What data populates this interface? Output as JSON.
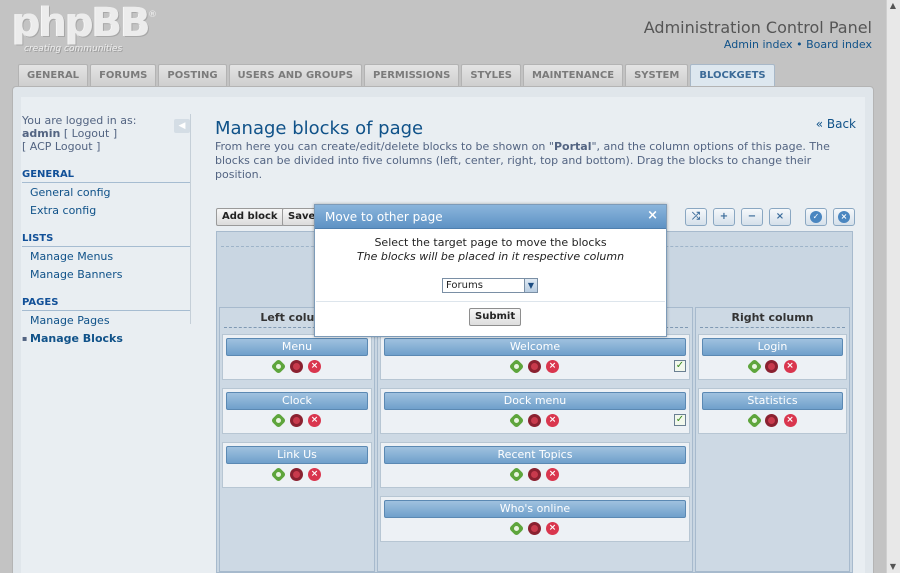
{
  "header": {
    "logo_text": "phpBB",
    "logo_tagline": "creating communities",
    "title": "Administration Control Panel",
    "links": [
      "Admin index",
      "Board index"
    ],
    "link_separator": "•"
  },
  "tabs": [
    "GENERAL",
    "FORUMS",
    "POSTING",
    "USERS AND GROUPS",
    "PERMISSIONS",
    "STYLES",
    "MAINTENANCE",
    "SYSTEM",
    "BLOCKGETS"
  ],
  "active_tab": "BLOCKGETS",
  "sidebar": {
    "logged_in_label": "You are logged in as:",
    "username": "admin",
    "logout": "[ Logout ]",
    "acp_logout": "[ ACP Logout ]",
    "sections": [
      {
        "title": "GENERAL",
        "items": [
          "General config",
          "Extra config"
        ]
      },
      {
        "title": "LISTS",
        "items": [
          "Manage Menus",
          "Manage Banners"
        ]
      },
      {
        "title": "PAGES",
        "items": [
          "Manage Pages",
          "Manage Blocks"
        ]
      }
    ],
    "active_item": "Manage Blocks"
  },
  "main": {
    "title": "Manage blocks of page",
    "back": "« Back",
    "desc_before": "From here you can create/edit/delete blocks to be shown on \"",
    "desc_page": "Portal",
    "desc_after": "\", and the column options of this page. The blocks can be divided into five columns (left, center, right, top and bottom). Drag the blocks to change their position.",
    "buttons": {
      "add_block": "Add block",
      "save": "Save"
    }
  },
  "columns": {
    "left": {
      "title": "Left column",
      "blocks": [
        "Menu",
        "Clock",
        "Link Us"
      ]
    },
    "center": {
      "blocks": [
        {
          "name": "Welcome",
          "checked": true
        },
        {
          "name": "Dock menu",
          "checked": true
        },
        {
          "name": "Recent Topics",
          "checked": false
        },
        {
          "name": "Who's online",
          "checked": false
        }
      ]
    },
    "right": {
      "title": "Right column",
      "blocks": [
        "Login",
        "Statistics"
      ]
    }
  },
  "modal": {
    "title": "Move to other page",
    "close": "×",
    "line1": "Select the target page to move the blocks",
    "line2": "The blocks will be placed in it respective column",
    "select_value": "Forums",
    "submit": "Submit"
  },
  "colors": {
    "accent": "#105289",
    "modal_header": "#6f9fcd",
    "block_header": "#7fabd3"
  }
}
